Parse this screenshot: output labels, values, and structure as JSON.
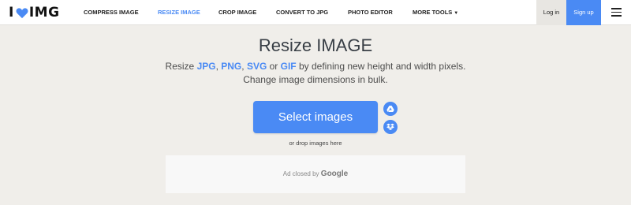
{
  "brand": {
    "prefix": "I",
    "name": "IMG",
    "heart_color": "#4a8af4"
  },
  "nav": {
    "items": [
      {
        "label": "COMPRESS IMAGE",
        "active": false
      },
      {
        "label": "RESIZE IMAGE",
        "active": true
      },
      {
        "label": "CROP IMAGE",
        "active": false
      },
      {
        "label": "CONVERT TO JPG",
        "active": false
      },
      {
        "label": "PHOTO EDITOR",
        "active": false
      },
      {
        "label": "MORE TOOLS",
        "active": false,
        "has_dropdown": true
      }
    ],
    "login_label": "Log in",
    "signup_label": "Sign up",
    "menu_icon": "hamburger-icon"
  },
  "hero": {
    "title": "Resize IMAGE",
    "line1_prefix": "Resize ",
    "formats": [
      "JPG",
      "PNG",
      "SVG",
      "GIF"
    ],
    "line1_sep1": ", ",
    "line1_sep2": ", ",
    "line1_or": " or ",
    "line1_suffix": " by defining new height and width pixels.",
    "line2": "Change image dimensions in bulk."
  },
  "upload": {
    "button_label": "Select images",
    "drop_text": "or drop images here",
    "cloud_sources": [
      "google-drive-icon",
      "dropbox-icon"
    ]
  },
  "ad": {
    "text": "Ad closed by",
    "brand": "Google"
  },
  "colors": {
    "accent": "#4a8af4",
    "background": "#f0eeea",
    "header": "#ffffff"
  }
}
